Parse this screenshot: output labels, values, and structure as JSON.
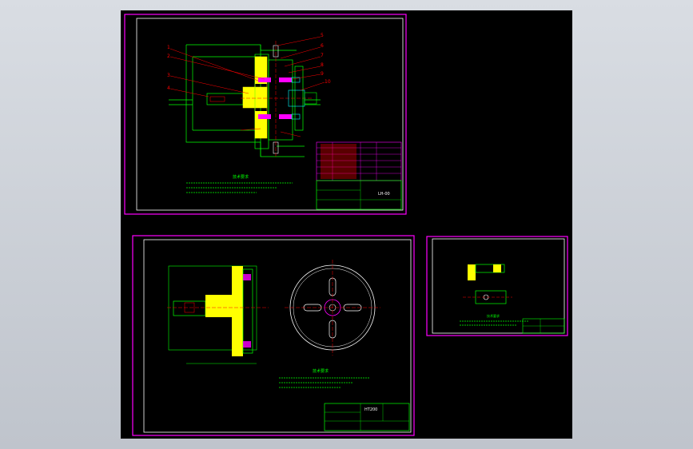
{
  "viewport": {
    "background": "#000000",
    "frame_color": "#ff00ff",
    "border_color": "#ffffff",
    "line_green": "#00ff00",
    "line_red": "#ff0000",
    "line_cyan": "#00ffff"
  },
  "sheets": [
    {
      "id": "assembly",
      "balloons": [
        "1",
        "2",
        "3",
        "4",
        "5",
        "6",
        "7",
        "8",
        "9",
        "10"
      ],
      "notes_title": "技术要求",
      "title_block_code": "LH-00"
    },
    {
      "id": "part-disc",
      "notes_title": "技术要求",
      "title_block_code": "HT200"
    },
    {
      "id": "part-small",
      "notes_title": "技术要求"
    }
  ]
}
